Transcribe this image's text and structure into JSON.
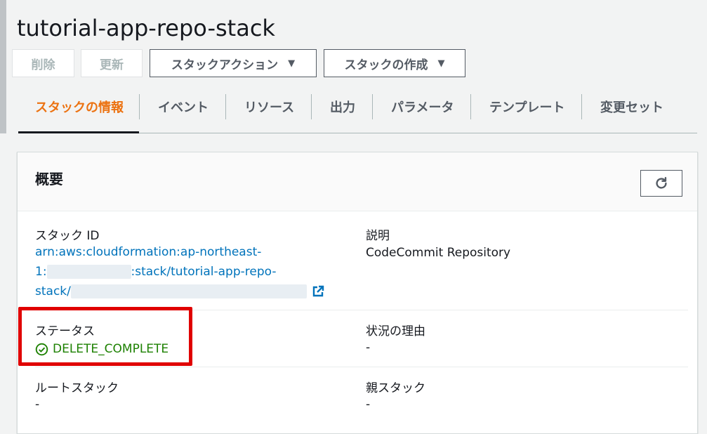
{
  "page": {
    "title": "tutorial-app-repo-stack"
  },
  "toolbar": {
    "delete_label": "削除",
    "update_label": "更新",
    "stack_actions_label": "スタックアクション",
    "create_stack_label": "スタックの作成",
    "caret": "▼"
  },
  "tabs": [
    {
      "label": "スタックの情報",
      "active": true
    },
    {
      "label": "イベント"
    },
    {
      "label": "リソース"
    },
    {
      "label": "出力"
    },
    {
      "label": "パラメータ"
    },
    {
      "label": "テンプレート"
    },
    {
      "label": "変更セット"
    }
  ],
  "overview": {
    "title": "概要",
    "stack_id_label": "スタック ID",
    "stack_id_line1": "arn:aws:cloudformation:ap-northeast-",
    "stack_id_line2_prefix": "1:",
    "stack_id_line2_suffix": ":stack/tutorial-app-repo-",
    "stack_id_line3_prefix": "stack/",
    "description_label": "説明",
    "description_value": "CodeCommit Repository",
    "status_label": "ステータス",
    "status_value": "DELETE_COMPLETE",
    "status_reason_label": "状況の理由",
    "status_reason_value": "-",
    "root_stack_label": "ルートスタック",
    "root_stack_value": "-",
    "parent_stack_label": "親スタック",
    "parent_stack_value": "-"
  },
  "colors": {
    "accent": "#ec7211",
    "link": "#0073bb",
    "success": "#1d8102",
    "highlight": "#e00000"
  },
  "icons": [
    "refresh-icon",
    "external-link-icon",
    "check-circle-icon",
    "caret-down-icon"
  ]
}
